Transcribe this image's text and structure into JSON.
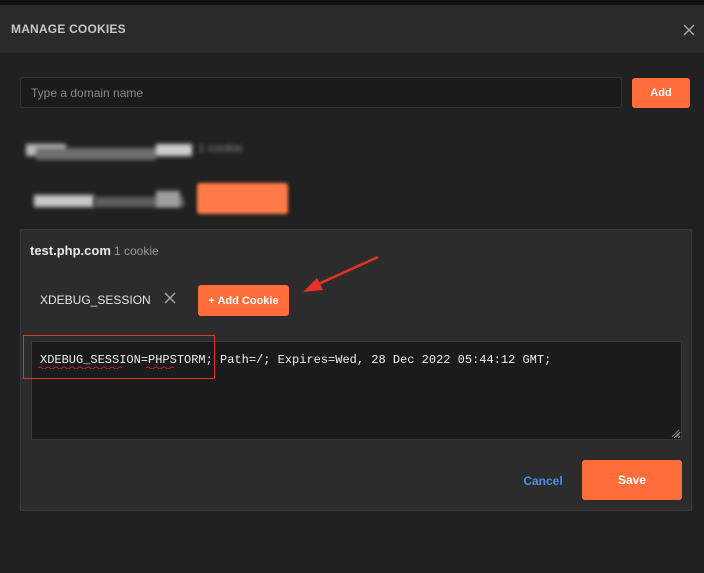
{
  "dialog": {
    "title": "MANAGE COOKIES",
    "close_icon": "close-icon"
  },
  "domain_input": {
    "placeholder": "Type a domain name",
    "value": ""
  },
  "add_button": {
    "label": "Add"
  },
  "blurred_entries": [
    {
      "name": "[redacted].com",
      "count": "1 cookie"
    },
    {
      "name": "[redacted]"
    }
  ],
  "active_domain": {
    "name": "test.php.com",
    "count": "1 cookie",
    "cookie_tab_label": "XDEBUG_SESSION",
    "add_cookie_label": "+ Add Cookie",
    "cookie_value": "XDEBUG_SESSION=PHPSTORM; Path=/; Expires=Wed, 28 Dec 2022 05:44:12 GMT;"
  },
  "footer": {
    "cancel_label": "Cancel",
    "save_label": "Save"
  },
  "colors": {
    "accent": "#ff6d3a",
    "link": "#4a90e2",
    "annotation": "#e63228"
  }
}
